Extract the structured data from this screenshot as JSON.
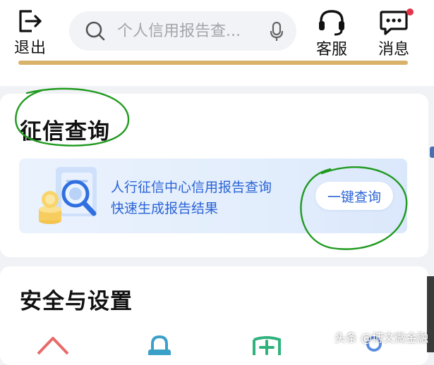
{
  "header": {
    "logout_label": "退出",
    "search_placeholder": "个人信用报告查...",
    "service_label": "客服",
    "message_label": "消息"
  },
  "credit_section": {
    "title": "征信查询",
    "banner_line1": "人行征信中心信用报告查询",
    "banner_line2": "快速生成报告结果",
    "button_label": "一键查询"
  },
  "security_section": {
    "title": "安全与设置"
  },
  "watermark": "头条 @博文微金融",
  "colors": {
    "accent_blue": "#2a63d6",
    "gold": "#d9b26a",
    "badge_red": "#e6334a",
    "annotation_green": "#1f9a1f"
  },
  "icons": [
    "logout-icon",
    "search-icon",
    "microphone-icon",
    "headset-icon",
    "message-icon",
    "document-magnifier-icon",
    "home-icon",
    "lock-icon",
    "shield-plus-icon",
    "user-icon"
  ]
}
